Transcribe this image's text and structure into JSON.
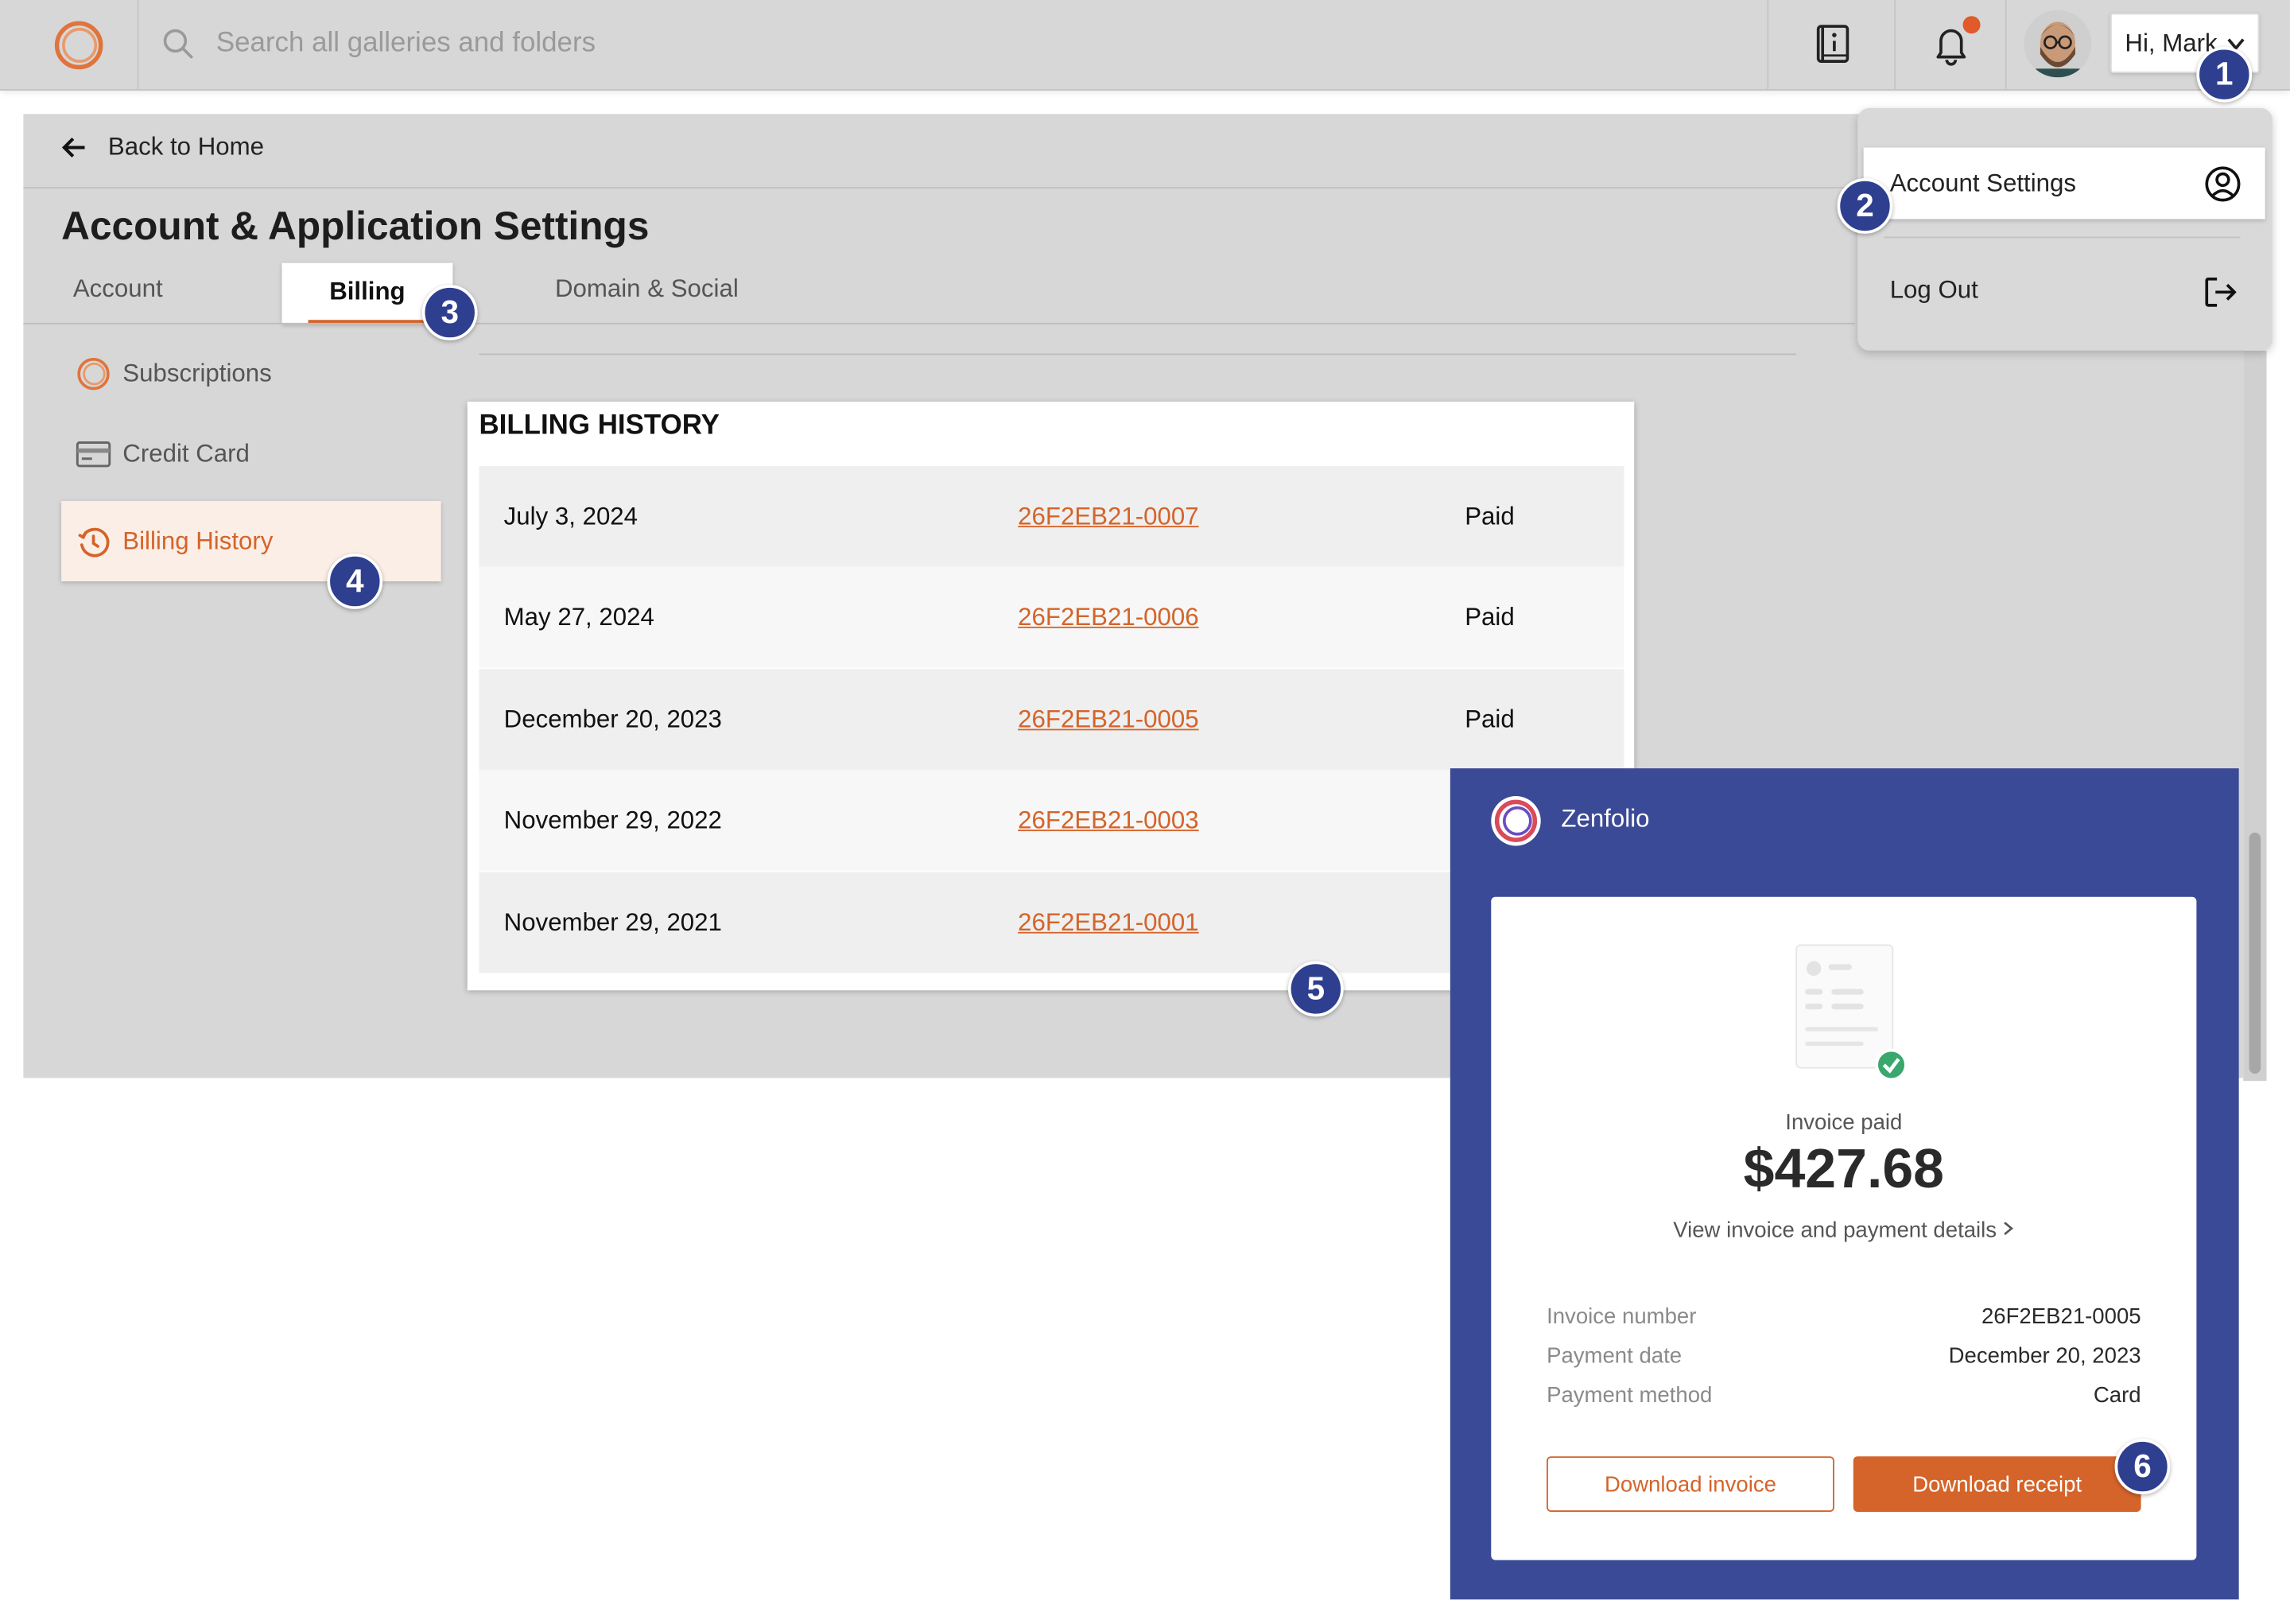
{
  "header": {
    "search_placeholder": "Search all galleries and folders",
    "greeting": "Hi, Mark"
  },
  "user_dropdown": {
    "account_settings": "Account Settings",
    "log_out": "Log Out"
  },
  "nav": {
    "back_label": "Back to Home"
  },
  "page": {
    "title": "Account & Application Settings",
    "tabs": [
      {
        "label": "Account"
      },
      {
        "label": "Billing"
      },
      {
        "label": "Domain & Social"
      }
    ]
  },
  "sidebar": {
    "items": [
      {
        "label": "Subscriptions"
      },
      {
        "label": "Credit Card"
      },
      {
        "label": "Billing History"
      }
    ]
  },
  "billing_history": {
    "title": "BILLING HISTORY",
    "rows": [
      {
        "date": "July 3, 2024",
        "invoice": "26F2EB21-0007",
        "status": "Paid"
      },
      {
        "date": "May 27, 2024",
        "invoice": "26F2EB21-0006",
        "status": "Paid"
      },
      {
        "date": "December 20, 2023",
        "invoice": "26F2EB21-0005",
        "status": "Paid"
      },
      {
        "date": "November 29, 2022",
        "invoice": "26F2EB21-0003",
        "status": ""
      },
      {
        "date": "November 29, 2021",
        "invoice": "26F2EB21-0001",
        "status": ""
      }
    ]
  },
  "receipt": {
    "brand": "Zenfolio",
    "status_label": "Invoice paid",
    "amount": "$427.68",
    "details_link": "View invoice and payment details",
    "details": [
      {
        "label": "Invoice number",
        "value": "26F2EB21-0005"
      },
      {
        "label": "Payment date",
        "value": "December 20, 2023"
      },
      {
        "label": "Payment method",
        "value": "Card"
      }
    ],
    "download_invoice": "Download invoice",
    "download_receipt": "Download receipt"
  },
  "step_badges": [
    "1",
    "2",
    "3",
    "4",
    "5",
    "6"
  ],
  "colors": {
    "accent": "#d4642a",
    "receipt_bg": "#3b4a96",
    "badge": "#2f3f8f"
  }
}
